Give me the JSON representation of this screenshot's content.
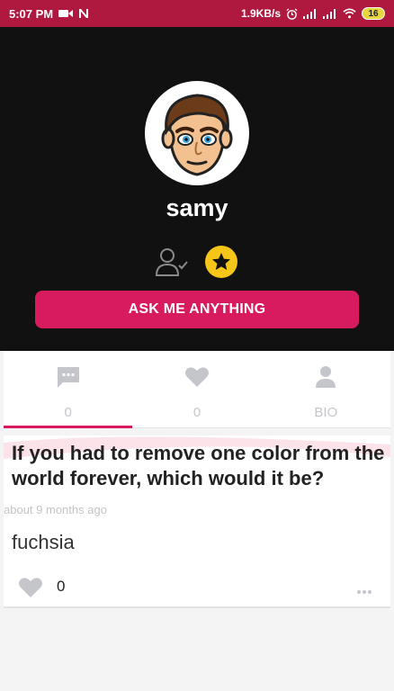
{
  "status_bar": {
    "time": "5:07 PM",
    "speed": "1.9KB/s",
    "battery": "16"
  },
  "profile": {
    "username": "samy",
    "ask_button_label": "ASK ME ANYTHING"
  },
  "tabs": [
    {
      "label": "0",
      "icon": "chat-bubble-icon",
      "active": true
    },
    {
      "label": "0",
      "icon": "heart-icon",
      "active": false
    },
    {
      "label": "BIO",
      "icon": "person-icon",
      "active": false
    }
  ],
  "post": {
    "question": "If you had to remove one color from the world forever, which would it be?",
    "timestamp": "about 9 months ago",
    "answer": "fuchsia",
    "likes": "0"
  },
  "colors": {
    "status_bar": "#b0193f",
    "header_bg": "#111111",
    "accent": "#d81b5f",
    "star": "#f5c518"
  }
}
